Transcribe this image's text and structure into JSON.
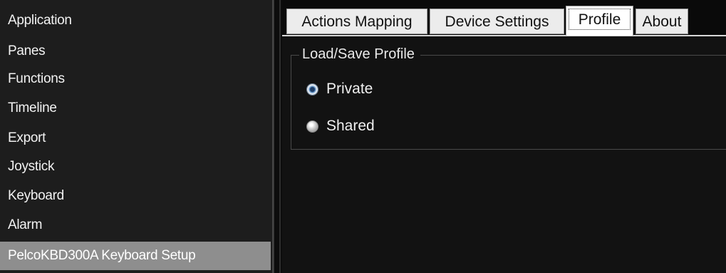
{
  "sidebar": {
    "items": [
      {
        "label": "Application"
      },
      {
        "label": "Panes"
      },
      {
        "label": "Functions"
      },
      {
        "label": "Timeline"
      },
      {
        "label": "Export"
      },
      {
        "label": "Joystick"
      },
      {
        "label": "Keyboard"
      },
      {
        "label": "Alarm"
      },
      {
        "label": "PelcoKBD300A Keyboard Setup",
        "selected": true
      }
    ]
  },
  "tabs": [
    {
      "label": "Actions Mapping",
      "active": false
    },
    {
      "label": "Device Settings",
      "active": false
    },
    {
      "label": "Profile",
      "active": true
    },
    {
      "label": "About",
      "active": false
    }
  ],
  "profile": {
    "group_title": "Load/Save Profile",
    "options": [
      {
        "label": "Private",
        "checked": true
      },
      {
        "label": "Shared",
        "checked": false
      }
    ]
  },
  "colors": {
    "sidebar_bg": "#1d1d1d",
    "selected_item_bg": "#8e8e8e",
    "content_bg": "#121212",
    "tab_bg": "#ececec",
    "text_light": "#f0f0f0"
  },
  "icons": {
    "radio_checked": "radio-checked-icon",
    "radio_unchecked": "radio-unchecked-icon"
  }
}
